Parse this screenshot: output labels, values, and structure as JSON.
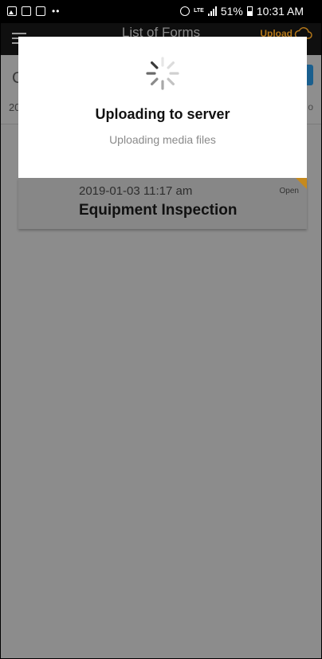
{
  "status_bar": {
    "battery_percent": "51%",
    "time": "10:31 AM",
    "network": "LTE",
    "left_icons": [
      "gallery-icon",
      "outlook-icon",
      "mail-icon",
      "more-dots-icon"
    ]
  },
  "app_bar": {
    "title": "List of Forms",
    "upload_label": "Upload",
    "upload_color": "#b3771a"
  },
  "background": {
    "header_initial": "C",
    "date_prefix": "20",
    "right_fragment": "o"
  },
  "form_card": {
    "date": "2019-01-03 11:17 am",
    "name": "Equipment Inspection",
    "status": "Open",
    "status_color": "#c68a1e"
  },
  "dialog": {
    "title": "Uploading to server",
    "message": "Uploading media files"
  }
}
